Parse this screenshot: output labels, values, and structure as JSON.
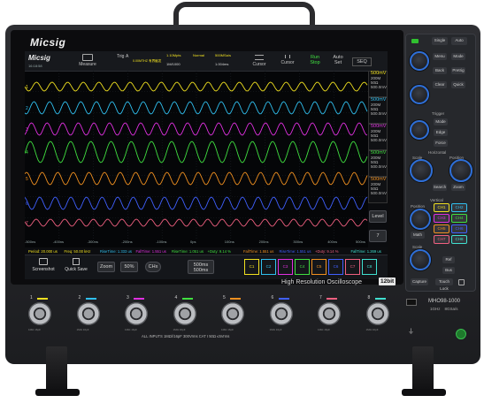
{
  "device": {
    "brand": "Micsig",
    "subtitle": "High Resolution Oscilloscope",
    "bits_badge": "12bit",
    "model": "MHO98-1000",
    "model_spec": "1GHz    8GSa/s",
    "inputs_note": "ALL INPUTS 1MΩ//16pF 300Vrms CAT I   50Ω ≤5Vrms",
    "channels": [
      "1",
      "2",
      "3",
      "4",
      "5",
      "6",
      "7",
      "8"
    ],
    "channel_colors": [
      "#f0e020",
      "#30c0f0",
      "#e030e0",
      "#40e040",
      "#f09020",
      "#4060ff",
      "#f06080",
      "#40e0d0"
    ],
    "channel_sublabel": "1MΩ 16pF"
  },
  "screen": {
    "logo": "Micsig",
    "time": "16:18:58",
    "toolbar": {
      "measure": "Measure",
      "trig": "Trig",
      "trig_ch": "A",
      "trig_desc": "0.00MTHZ 有界触发",
      "sample1": "1.10Mpts",
      "sample2": "Normal",
      "sample3": "500MSa/s",
      "sample4": "1M/1000",
      "sample5": "1.004ms",
      "cursor1": "Cursor",
      "cursor2": "Cursor",
      "run": "Run",
      "stop": "Stop",
      "auto": "Auto",
      "set": "Set",
      "seq": "SEQ"
    },
    "ch_labels": [
      {
        "v": "500mV",
        "l1": "200M",
        "l2": "50Ω",
        "l3": "500.0mV"
      },
      {
        "v": "500mV",
        "l1": "200M",
        "l2": "50Ω",
        "l3": "500.0mV"
      },
      {
        "v": "500mV",
        "l1": "200M",
        "l2": "50Ω",
        "l3": "500.0mV"
      },
      {
        "v": "500mV",
        "l1": "200M",
        "l2": "50Ω",
        "l3": "500.0mV"
      },
      {
        "v": "500mV",
        "l1": "200M",
        "l2": "50Ω",
        "l3": "500.0mV"
      }
    ],
    "side_buttons": [
      "Level",
      "7",
      "8"
    ],
    "time_ticks": [
      "-500ns",
      "-400ns",
      "-300ns",
      "-200ns",
      "-100ns",
      "0ps",
      "100ns",
      "200ns",
      "300ns",
      "400ns",
      "500ns"
    ],
    "measurements": [
      {
        "text": "Period: 20.000 us",
        "color": "#f0e020"
      },
      {
        "text": "Freq: 50.00 kHz",
        "color": "#f0e020"
      },
      {
        "text": "RiseTime: 1.333 us",
        "color": "#30c0f0"
      },
      {
        "text": "FallTime: 1.551 us",
        "color": "#e030e0"
      },
      {
        "text": "RiseTime: 1.051 us",
        "color": "#40e040"
      },
      {
        "text": "+Duty: 9.14 %",
        "color": "#40e040"
      },
      {
        "text": "FallTime: 1.551 us",
        "color": "#f09020"
      },
      {
        "text": "RiseTime: 1.551 us",
        "color": "#4060ff"
      },
      {
        "text": "+Duty: 9.14 %",
        "color": "#f06080"
      },
      {
        "text": "FallTime: 1.269 us",
        "color": "#40e0d0"
      }
    ],
    "bottom_bar": {
      "screenshot": "Screenshot",
      "quick_save": "Quick Save",
      "zoom": "Zoom",
      "pct": "50%",
      "chx": "CHx",
      "timebase1": "500ms",
      "timebase2": "500ms"
    }
  },
  "panel": {
    "top_buttons": [
      "Single",
      "Auto"
    ],
    "menu_buttons": [
      "Menu",
      "Mode",
      "Back",
      "Pretrig",
      "Clear",
      "Quick"
    ],
    "trigger_title": "Trigger",
    "trigger_buttons": [
      "Mode",
      "Edge",
      "Force"
    ],
    "horizontal_title": "Horizontal",
    "horizontal_labels": [
      "Scale",
      "Position",
      "Search",
      "Zoom"
    ],
    "vertical_title": "Vertical",
    "vertical_labels": [
      "Position",
      "Scale",
      "Math",
      "Bus",
      "Ref"
    ],
    "ch_buttons": [
      "CH1",
      "CH2",
      "CH3",
      "CH4",
      "CH5",
      "CH6",
      "CH7",
      "CH8"
    ],
    "bottom_labels": [
      "Capture",
      "Touch Lock"
    ]
  }
}
